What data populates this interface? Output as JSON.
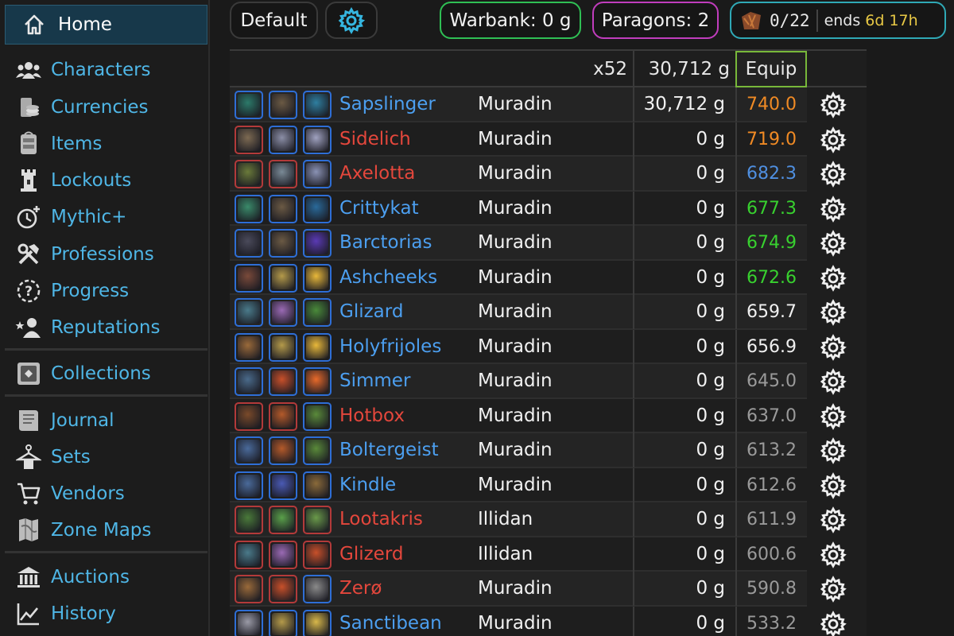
{
  "sidebar": {
    "home": {
      "label": "Home",
      "icon": "home-icon"
    },
    "items": [
      {
        "label": "Characters",
        "icon": "characters-icon"
      },
      {
        "label": "Currencies",
        "icon": "currencies-icon"
      },
      {
        "label": "Items",
        "icon": "items-icon"
      },
      {
        "label": "Lockouts",
        "icon": "lockouts-icon"
      },
      {
        "label": "Mythic+",
        "icon": "mythic-plus-icon"
      },
      {
        "label": "Professions",
        "icon": "professions-icon"
      },
      {
        "label": "Progress",
        "icon": "progress-icon"
      },
      {
        "label": "Reputations",
        "icon": "reputations-icon"
      },
      {
        "label": "Collections",
        "icon": "collections-icon"
      },
      {
        "label": "Journal",
        "icon": "journal-icon"
      },
      {
        "label": "Sets",
        "icon": "sets-icon"
      },
      {
        "label": "Vendors",
        "icon": "vendors-icon"
      },
      {
        "label": "Zone Maps",
        "icon": "zone-maps-icon"
      },
      {
        "label": "Auctions",
        "icon": "auctions-icon"
      },
      {
        "label": "History",
        "icon": "history-icon"
      }
    ]
  },
  "topbar": {
    "view_label": "Default",
    "warbank": "Warbank: 0 g",
    "paragons": "Paragons: 2",
    "weekly_count": "0/22",
    "ends_label": "ends",
    "ends_time": "6d 17h"
  },
  "colors": {
    "accent_link": "#4fb6e6",
    "warbank_border": "#2fbf54",
    "paragons_border": "#c13dbd",
    "weekly_border": "#2fa9b6",
    "equip_border": "#78b83a",
    "name_blue": "#4c9ff0",
    "name_red": "#e4473c",
    "ilvl_orange": "#f08a24",
    "ilvl_blue": "#4f8fe0",
    "ilvl_green": "#38d12f",
    "ilvl_white": "#f0f0f0",
    "ilvl_gray": "#9a9a9a"
  },
  "table": {
    "header": {
      "count": "x52",
      "gold": "30,712 g",
      "equip": "Equip"
    },
    "rows": [
      {
        "name": "Sapslinger",
        "name_color": "blue",
        "realm": "Muradin",
        "gold": "30,712 g",
        "ilvl": "740.0",
        "ilvl_color": "orange",
        "icons": [
          [
            "blue",
            "#2c7a6a"
          ],
          [
            "blue",
            "#6b5a44"
          ],
          [
            "blue",
            "#2f7fa0"
          ]
        ]
      },
      {
        "name": "Sidelich",
        "name_color": "red",
        "realm": "Muradin",
        "gold": "0 g",
        "ilvl": "719.0",
        "ilvl_color": "orange",
        "icons": [
          [
            "red",
            "#7d6a52"
          ],
          [
            "blue",
            "#8b8ea6"
          ],
          [
            "blue",
            "#a0a2c0"
          ]
        ]
      },
      {
        "name": "Axelotta",
        "name_color": "red",
        "realm": "Muradin",
        "gold": "0 g",
        "ilvl": "682.3",
        "ilvl_color": "blue",
        "icons": [
          [
            "red",
            "#6a7a3a"
          ],
          [
            "red",
            "#7a8a96"
          ],
          [
            "blue",
            "#8a92b4"
          ]
        ]
      },
      {
        "name": "Crittykat",
        "name_color": "blue",
        "realm": "Muradin",
        "gold": "0 g",
        "ilvl": "677.3",
        "ilvl_color": "green",
        "icons": [
          [
            "blue",
            "#3a8a6a"
          ],
          [
            "blue",
            "#6b5a44"
          ],
          [
            "blue",
            "#2a6a9a"
          ]
        ]
      },
      {
        "name": "Barctorias",
        "name_color": "blue",
        "realm": "Muradin",
        "gold": "0 g",
        "ilvl": "674.9",
        "ilvl_color": "green",
        "icons": [
          [
            "blue",
            "#4a4a5a"
          ],
          [
            "blue",
            "#6b5a44"
          ],
          [
            "blue",
            "#5a3ab4"
          ]
        ]
      },
      {
        "name": "Ashcheeks",
        "name_color": "blue",
        "realm": "Muradin",
        "gold": "0 g",
        "ilvl": "672.6",
        "ilvl_color": "green",
        "icons": [
          [
            "blue",
            "#7a4a3a"
          ],
          [
            "blue",
            "#b49a4a"
          ],
          [
            "blue",
            "#e8b83a"
          ]
        ]
      },
      {
        "name": "Glizard",
        "name_color": "blue",
        "realm": "Muradin",
        "gold": "0 g",
        "ilvl": "659.7",
        "ilvl_color": "white",
        "icons": [
          [
            "blue",
            "#4a7a8a"
          ],
          [
            "blue",
            "#9a6ab4"
          ],
          [
            "blue",
            "#4a8a3a"
          ]
        ]
      },
      {
        "name": "Holyfrijoles",
        "name_color": "blue",
        "realm": "Muradin",
        "gold": "0 g",
        "ilvl": "656.9",
        "ilvl_color": "white",
        "icons": [
          [
            "blue",
            "#9a6a3a"
          ],
          [
            "blue",
            "#b49a4a"
          ],
          [
            "blue",
            "#e8b83a"
          ]
        ]
      },
      {
        "name": "Simmer",
        "name_color": "blue",
        "realm": "Muradin",
        "gold": "0 g",
        "ilvl": "645.0",
        "ilvl_color": "gray",
        "icons": [
          [
            "blue",
            "#4a6a8a"
          ],
          [
            "blue",
            "#c8502a"
          ],
          [
            "blue",
            "#e86a2a"
          ]
        ]
      },
      {
        "name": "Hotbox",
        "name_color": "red",
        "realm": "Muradin",
        "gold": "0 g",
        "ilvl": "637.0",
        "ilvl_color": "gray",
        "icons": [
          [
            "red",
            "#7a4a2a"
          ],
          [
            "red",
            "#b45a2a"
          ],
          [
            "blue",
            "#5a8a3a"
          ]
        ]
      },
      {
        "name": "Boltergeist",
        "name_color": "blue",
        "realm": "Muradin",
        "gold": "0 g",
        "ilvl": "613.2",
        "ilvl_color": "gray",
        "icons": [
          [
            "blue",
            "#4a6a9a"
          ],
          [
            "blue",
            "#b45a2a"
          ],
          [
            "blue",
            "#5a8a3a"
          ]
        ]
      },
      {
        "name": "Kindle",
        "name_color": "blue",
        "realm": "Muradin",
        "gold": "0 g",
        "ilvl": "612.6",
        "ilvl_color": "gray",
        "icons": [
          [
            "blue",
            "#4a6a9a"
          ],
          [
            "blue",
            "#4a5ab4"
          ],
          [
            "blue",
            "#8a6a3a"
          ]
        ]
      },
      {
        "name": "Lootakris",
        "name_color": "red",
        "realm": "Illidan",
        "gold": "0 g",
        "ilvl": "611.9",
        "ilvl_color": "gray",
        "icons": [
          [
            "red",
            "#4a7a3a"
          ],
          [
            "red",
            "#5aa04a"
          ],
          [
            "red",
            "#6a9a4a"
          ]
        ]
      },
      {
        "name": "Glizerd",
        "name_color": "red",
        "realm": "Illidan",
        "gold": "0 g",
        "ilvl": "600.6",
        "ilvl_color": "gray",
        "icons": [
          [
            "red",
            "#4a7a8a"
          ],
          [
            "red",
            "#9a6ab4"
          ],
          [
            "red",
            "#c8502a"
          ]
        ]
      },
      {
        "name": "Zerø",
        "name_color": "red",
        "realm": "Muradin",
        "gold": "0 g",
        "ilvl": "590.8",
        "ilvl_color": "gray",
        "icons": [
          [
            "red",
            "#9a6a3a"
          ],
          [
            "red",
            "#c8502a"
          ],
          [
            "blue",
            "#8a8a8a"
          ]
        ]
      },
      {
        "name": "Sanctibean",
        "name_color": "blue",
        "realm": "Muradin",
        "gold": "0 g",
        "ilvl": "533.2",
        "ilvl_color": "gray",
        "icons": [
          [
            "blue",
            "#9a9aa6"
          ],
          [
            "blue",
            "#b49a4a"
          ],
          [
            "blue",
            "#d8b84a"
          ]
        ]
      }
    ]
  }
}
